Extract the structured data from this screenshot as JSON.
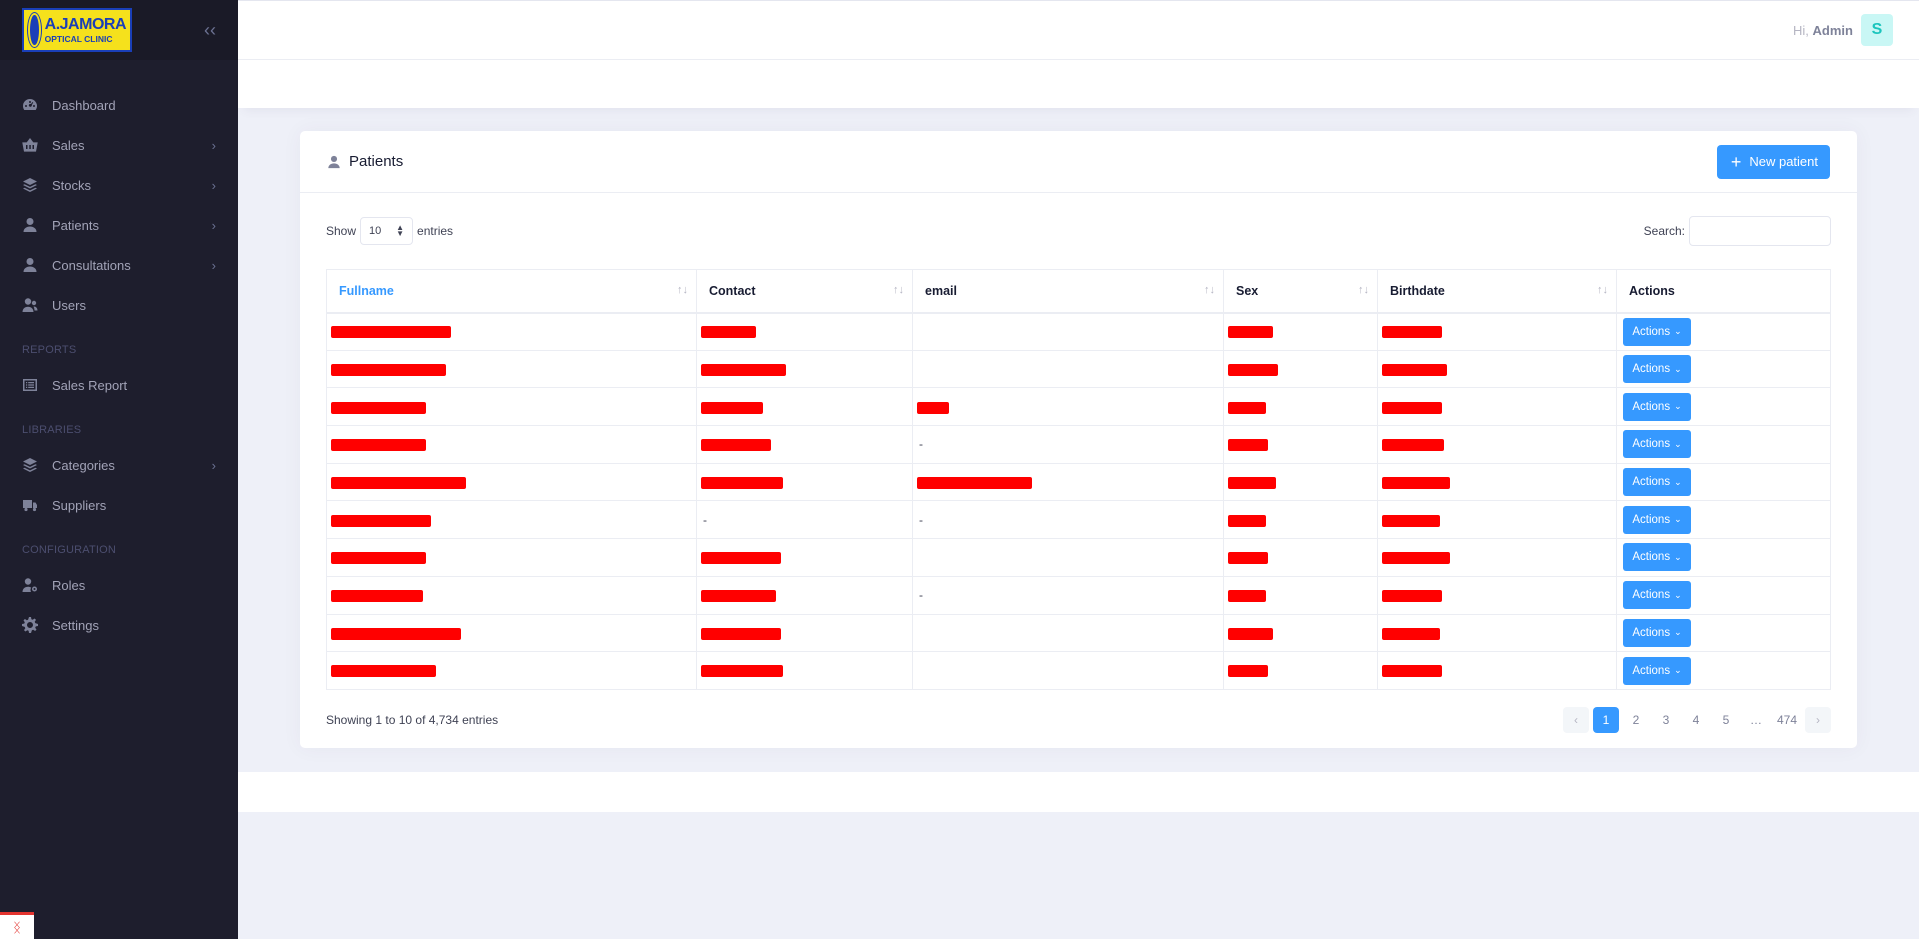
{
  "brand": {
    "line1": "A.JAMORA",
    "line2": "OPTICAL CLINIC"
  },
  "sidebar": {
    "collapse_icon": "chevrons-left-icon",
    "items": [
      {
        "label": "Dashboard",
        "icon": "dashboard-icon",
        "has_children": false
      },
      {
        "label": "Sales",
        "icon": "basket-icon",
        "has_children": true
      },
      {
        "label": "Stocks",
        "icon": "layers-icon",
        "has_children": true
      },
      {
        "label": "Patients",
        "icon": "user-icon",
        "has_children": true
      },
      {
        "label": "Consultations",
        "icon": "user-icon",
        "has_children": true
      },
      {
        "label": "Users",
        "icon": "users-icon",
        "has_children": false
      }
    ],
    "reports_section": "REPORTS",
    "reports_items": [
      {
        "label": "Sales Report",
        "icon": "list-icon"
      }
    ],
    "libraries_section": "LIBRARIES",
    "libraries_items": [
      {
        "label": "Categories",
        "icon": "layers-icon",
        "has_children": true
      },
      {
        "label": "Suppliers",
        "icon": "truck-icon",
        "has_children": false
      }
    ],
    "configuration_section": "CONFIGURATION",
    "configuration_items": [
      {
        "label": "Roles",
        "icon": "user-gear-icon"
      },
      {
        "label": "Settings",
        "icon": "gear-icon"
      }
    ]
  },
  "header": {
    "greeting": "Hi,",
    "user_name": "Admin",
    "avatar_letter": "S"
  },
  "card": {
    "title": "Patients",
    "new_button": "New patient"
  },
  "controls": {
    "show_label": "Show",
    "page_length": "10",
    "entries_label": "entries",
    "search_label": "Search:",
    "search_value": ""
  },
  "table": {
    "columns": [
      "Fullname",
      "Contact",
      "email",
      "Sex",
      "Birthdate",
      "Actions"
    ],
    "sort_indicator": "↑↓",
    "action_label": "Actions",
    "rows": [
      {
        "fullname": "",
        "contact": "",
        "email": "",
        "sex": "",
        "birthdate": ""
      },
      {
        "fullname": "",
        "contact": "",
        "email": "",
        "sex": "",
        "birthdate": ""
      },
      {
        "fullname": "",
        "contact": "",
        "email": "",
        "sex": "",
        "birthdate": ""
      },
      {
        "fullname": "",
        "contact": "",
        "email": "-",
        "sex": "",
        "birthdate": ""
      },
      {
        "fullname": "",
        "contact": "",
        "email": "",
        "sex": "",
        "birthdate": ""
      },
      {
        "fullname": "",
        "contact": "-",
        "email": "-",
        "sex": "",
        "birthdate": ""
      },
      {
        "fullname": "",
        "contact": "",
        "email": "",
        "sex": "",
        "birthdate": ""
      },
      {
        "fullname": "",
        "contact": "",
        "email": "-",
        "sex": "",
        "birthdate": ""
      },
      {
        "fullname": "",
        "contact": "",
        "email": "",
        "sex": "",
        "birthdate": ""
      },
      {
        "fullname": "",
        "contact": "",
        "email": "",
        "sex": "",
        "birthdate": ""
      }
    ]
  },
  "footer": {
    "info": "Showing 1 to 10 of 4,734 entries",
    "pages": [
      "1",
      "2",
      "3",
      "4",
      "5",
      "…",
      "474"
    ],
    "active_page": "1",
    "prev": "‹",
    "next": "›"
  },
  "colors": {
    "primary": "#3699ff",
    "sidebar": "#1e1e2d",
    "redaction": "#ff0000"
  }
}
